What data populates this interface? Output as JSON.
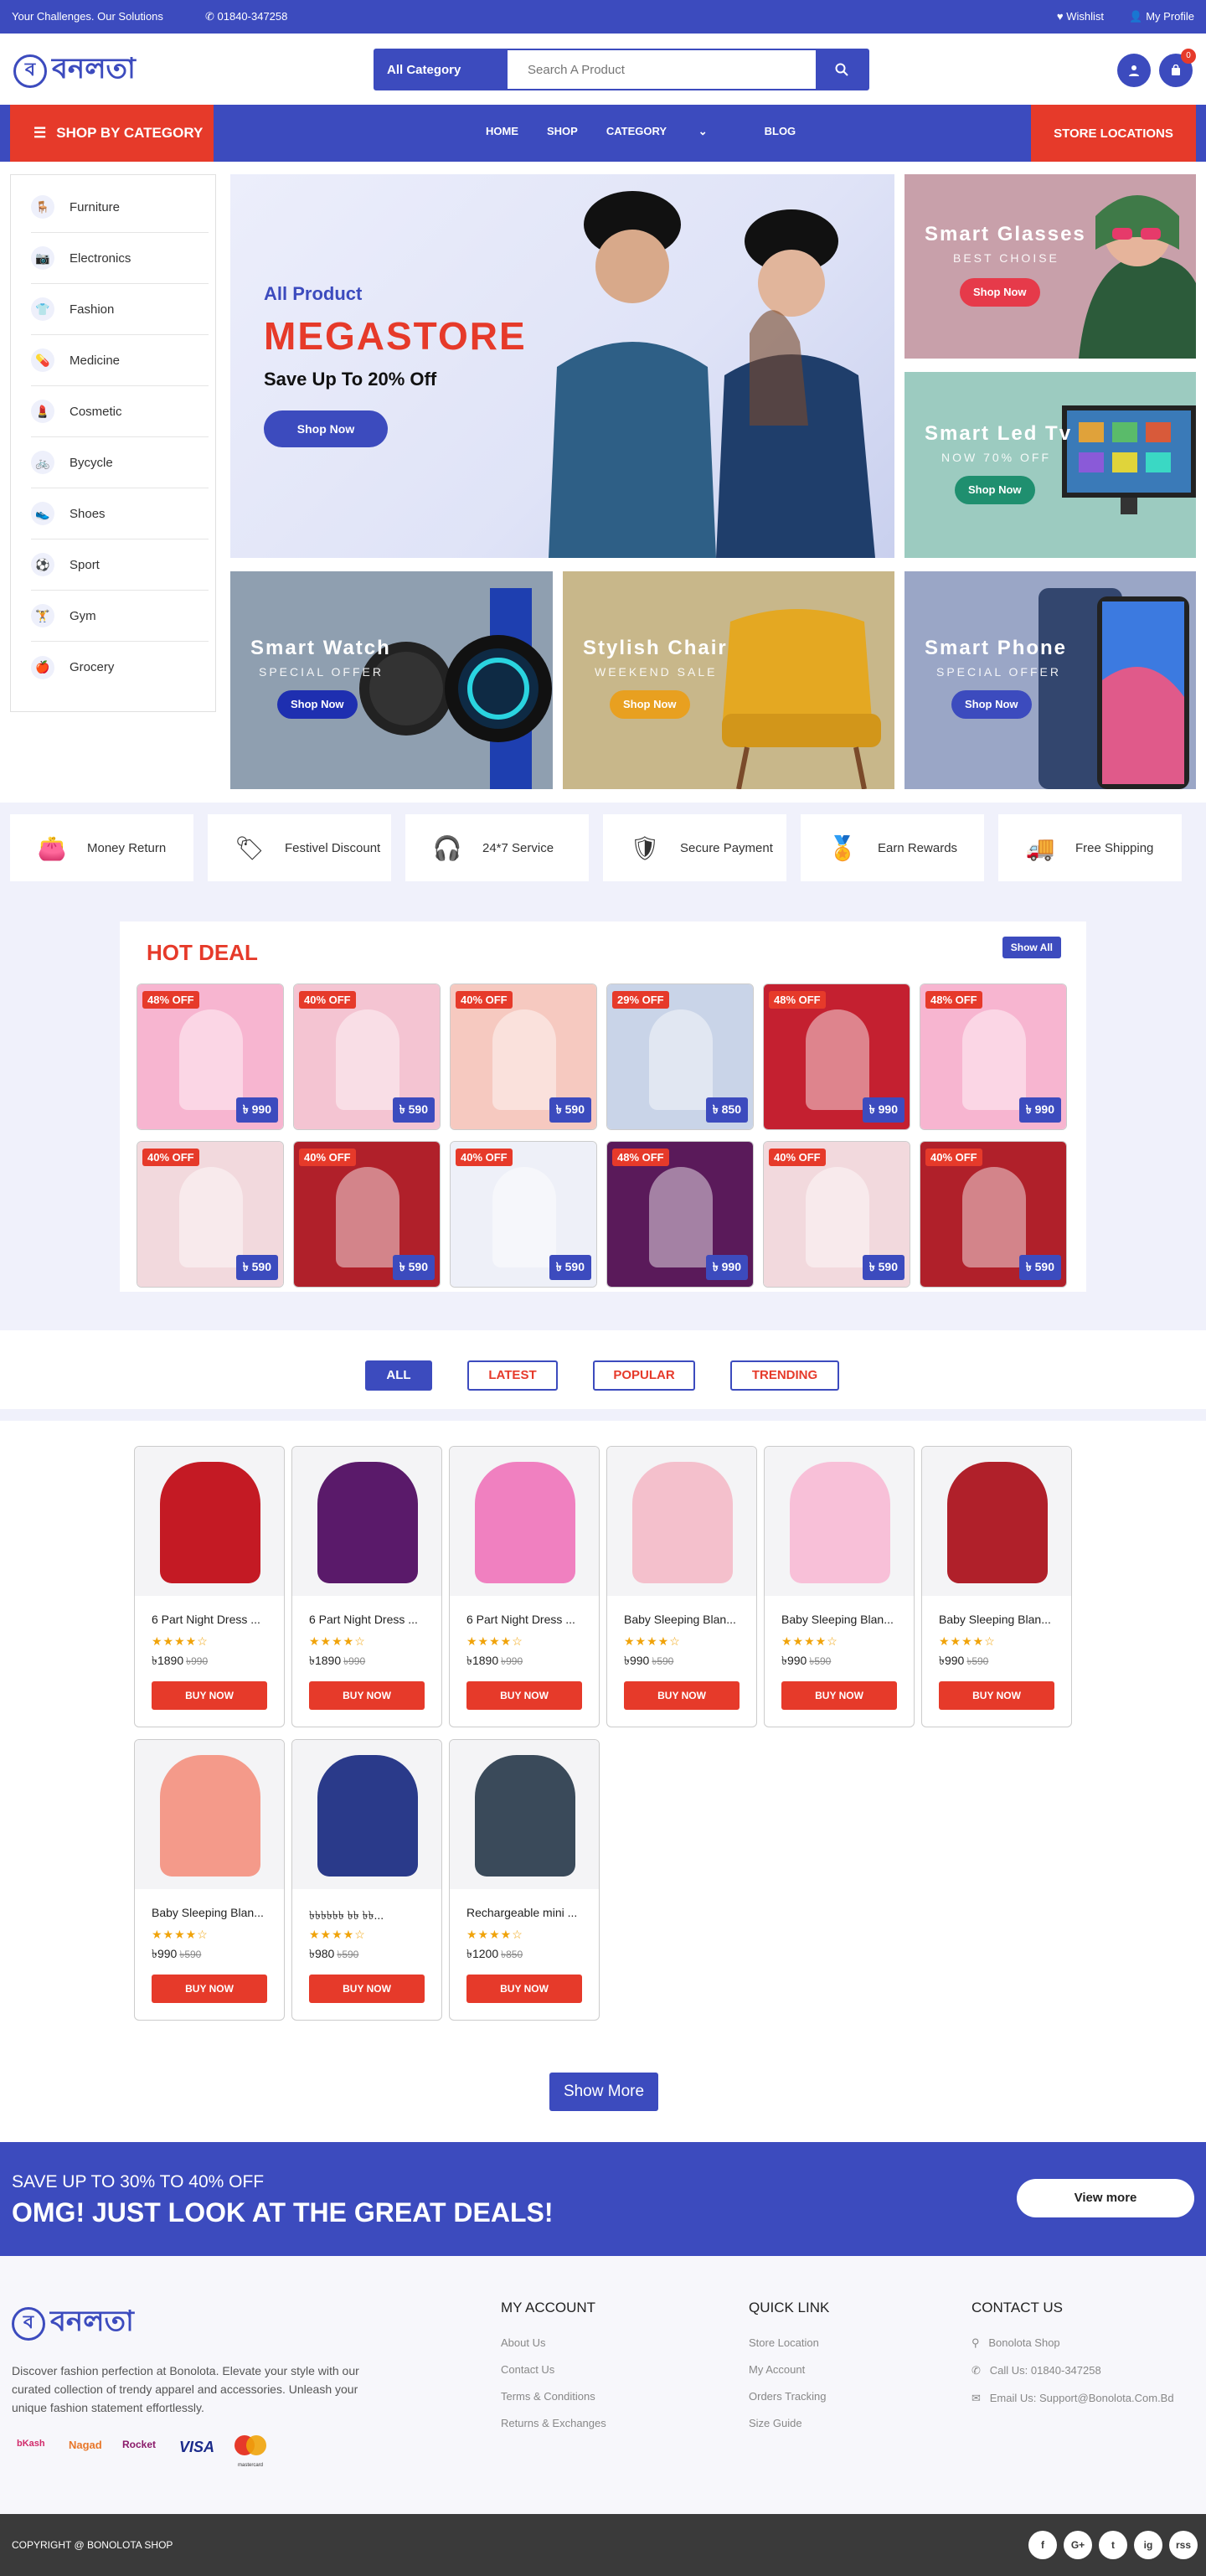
{
  "topbar": {
    "tagline": "Your Challenges. Our Solutions",
    "phone": "01840-347258",
    "wishlist": "Wishlist",
    "profile": "My Profile"
  },
  "header": {
    "logo_text": "বনলতা",
    "search_category": "All Category",
    "search_placeholder": "Search A Product",
    "cart_count": "0"
  },
  "nav": {
    "shop_by_category": "SHOP BY CATEGORY",
    "links": [
      "HOME",
      "SHOP",
      "CATEGORY",
      "BLOG"
    ],
    "store_locations": "STORE LOCATIONS"
  },
  "categories": [
    "Furniture",
    "Electronics",
    "Fashion",
    "Medicine",
    "Cosmetic",
    "Bycycle",
    "Shoes",
    "Sport",
    "Gym",
    "Grocery"
  ],
  "hero": {
    "subtitle": "All Product",
    "title": "MEGASTORE",
    "save": "Save Up To 20% Off",
    "button": "Shop Now"
  },
  "banners": [
    {
      "title": "Smart Glasses",
      "sub": "BEST CHOISE",
      "button": "Shop Now"
    },
    {
      "title": "Smart Led Tv",
      "sub": "NOW 70% OFF",
      "button": "Shop Now"
    },
    {
      "title": "Smart Watch",
      "sub": "SPECIAL OFFER",
      "button": "Shop Now"
    },
    {
      "title": "Stylish Chair",
      "sub": "WEEKEND SALE",
      "button": "Shop Now"
    },
    {
      "title": "Smart Phone",
      "sub": "SPECIAL OFFER",
      "button": "Shop Now"
    }
  ],
  "features": [
    "Money Return",
    "Festivel Discount",
    "24*7 Service",
    "Secure Payment",
    "Earn Rewards",
    "Free Shipping"
  ],
  "hot_deal": {
    "title": "HOT DEAL",
    "show_all": "Show All",
    "items": [
      {
        "off": "48% OFF",
        "price": "৳ 990"
      },
      {
        "off": "40% OFF",
        "price": "৳ 590"
      },
      {
        "off": "40% OFF",
        "price": "৳ 590"
      },
      {
        "off": "29% OFF",
        "price": "৳ 850"
      },
      {
        "off": "48% OFF",
        "price": "৳ 990"
      },
      {
        "off": "48% OFF",
        "price": "৳ 990"
      },
      {
        "off": "40% OFF",
        "price": "৳ 590"
      },
      {
        "off": "40% OFF",
        "price": "৳ 590"
      },
      {
        "off": "40% OFF",
        "price": "৳ 590"
      },
      {
        "off": "48% OFF",
        "price": "৳ 990"
      },
      {
        "off": "40% OFF",
        "price": "৳ 590"
      },
      {
        "off": "40% OFF",
        "price": "৳ 590"
      }
    ]
  },
  "tabs": [
    "ALL",
    "LATEST",
    "POPULAR",
    "TRENDING"
  ],
  "products": [
    {
      "name": "6 Part Night Dress ...",
      "price": "৳1890",
      "old": "৳990",
      "button": "BUY NOW"
    },
    {
      "name": "6 Part Night Dress ...",
      "price": "৳1890",
      "old": "৳990",
      "button": "BUY NOW"
    },
    {
      "name": "6 Part Night Dress ...",
      "price": "৳1890",
      "old": "৳990",
      "button": "BUY NOW"
    },
    {
      "name": "Baby Sleeping Blan...",
      "price": "৳990",
      "old": "৳590",
      "button": "BUY NOW"
    },
    {
      "name": "Baby Sleeping Blan...",
      "price": "৳990",
      "old": "৳590",
      "button": "BUY NOW"
    },
    {
      "name": "Baby Sleeping Blan...",
      "price": "৳990",
      "old": "৳590",
      "button": "BUY NOW"
    },
    {
      "name": "Baby Sleeping Blan...",
      "price": "৳990",
      "old": "৳590",
      "button": "BUY NOW"
    },
    {
      "name": "৳৳৳৳৳৳ ৳৳ ৳৳...",
      "price": "৳980",
      "old": "৳590",
      "button": "BUY NOW"
    },
    {
      "name": "Rechargeable mini ...",
      "price": "৳1200",
      "old": "৳850",
      "button": "BUY NOW"
    }
  ],
  "show_more": "Show More",
  "promo": {
    "line1": "SAVE UP TO 30% TO 40% OFF",
    "line2": "OMG! JUST LOOK AT THE GREAT DEALS!",
    "button": "View more"
  },
  "footer": {
    "description": "Discover fashion perfection at Bonolota. Elevate your style with our curated collection of trendy apparel and accessories. Unleash your unique fashion statement effortlessly.",
    "my_account": {
      "title": "MY ACCOUNT",
      "links": [
        "About Us",
        "Contact Us",
        "Terms & Conditions",
        "Returns & Exchanges"
      ]
    },
    "quick_link": {
      "title": "QUICK LINK",
      "links": [
        "Store Location",
        "My Account",
        "Orders Tracking",
        "Size Guide"
      ]
    },
    "contact": {
      "title": "CONTACT US",
      "items": [
        "Bonolota Shop",
        "Call Us: 01840-347258",
        "Email Us: Support@Bonolota.Com.Bd"
      ]
    },
    "payments": [
      "bKash",
      "Nagad",
      "Rocket",
      "VISA",
      "mastercard"
    ]
  },
  "copyright": "COPYRIGHT @ BONOLOTA SHOP",
  "social": [
    "f",
    "G+",
    "t",
    "ig",
    "rss"
  ]
}
